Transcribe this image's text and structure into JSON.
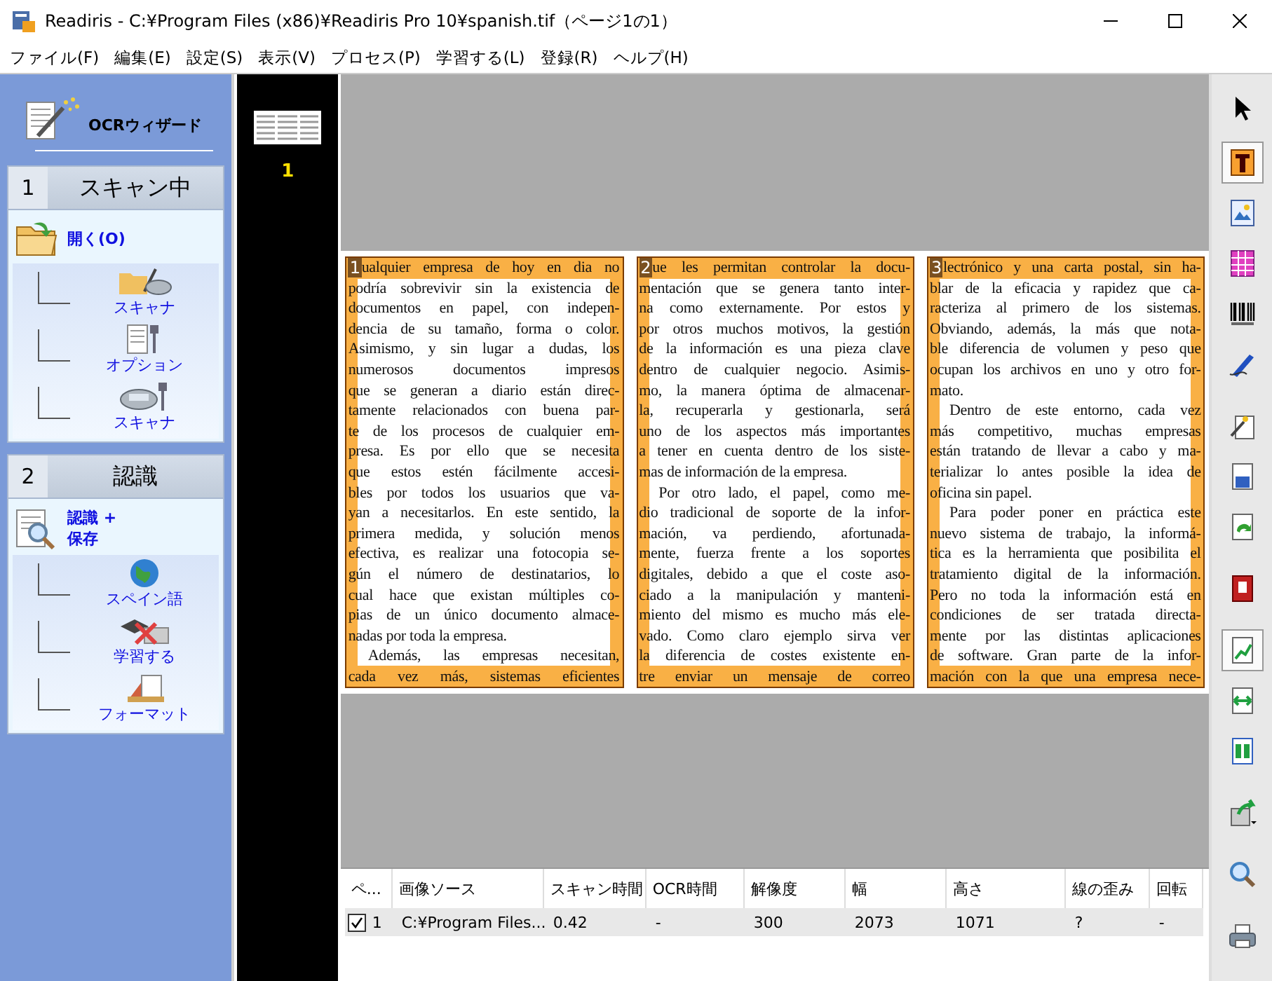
{
  "window": {
    "title": "Readiris - C:¥Program Files (x86)¥Readiris Pro 10¥spanish.tif（ページ1の1）"
  },
  "menu": [
    "ファイル(F)",
    "編集(E)",
    "設定(S)",
    "表示(V)",
    "プロセス(P)",
    "学習する(L)",
    "登録(R)",
    "ヘルプ(H)"
  ],
  "wizard": {
    "title": "OCRウィザード",
    "sections": [
      {
        "number": "1",
        "title": "スキャン中",
        "main": [
          "開く(O)"
        ],
        "items": [
          "スキャナ",
          "オプション",
          "スキャナ"
        ]
      },
      {
        "number": "2",
        "title": "認識",
        "main": [
          "認識 +",
          "保存"
        ],
        "items": [
          "スペイン語",
          "学習する",
          "フォーマット"
        ]
      }
    ]
  },
  "thumbnails": [
    {
      "number": "1"
    }
  ],
  "zones": [
    {
      "number": "1",
      "paragraphs": [
        {
          "indent": false,
          "lines": [
            "ualquier empresa de hoy en dia no",
            "podría sobrevivir sin la existencia de",
            "documentos en papel, con indepen-",
            "dencia de su tamaño, forma o color.",
            "Asimismo, y sin lugar a dudas, los",
            "numerosos documentos impresos",
            "que se generan a diario están direc-",
            "tamente relacionados con buena par-",
            "te de los procesos de cualquier em-",
            "presa. Es por ello que se necesita",
            "que estos estén fácilmente accesi-",
            "bles por todos los usuarios que va-",
            "yan a necesitarlos. En este sentido, la",
            "primera medida, y solución menos",
            "efectiva, es realizar una fotocopia se-",
            "gún el número de destinatarios, lo",
            "cual hace que existan múltiples co-",
            "pias de un único documento almace-",
            "nadas por toda la empresa."
          ]
        },
        {
          "indent": true,
          "lines": [
            "Además, las empresas necesitan,",
            "cada vez más, sistemas eficientes"
          ]
        }
      ]
    },
    {
      "number": "2",
      "paragraphs": [
        {
          "indent": false,
          "lines": [
            "ue les permitan controlar la docu-",
            "mentación que se genera tanto inter-",
            "na como externamente. Por estos y",
            "por otros muchos motivos, la gestión",
            "de la información es una pieza clave",
            "dentro de cualquier negocio. Asimis-",
            "mo, la manera óptima de almacenar-",
            "la, recuperarla y gestionarla, será",
            "uno de los aspectos más importantes",
            "a tener en cuenta dentro de los siste-",
            "mas de información de la empresa."
          ]
        },
        {
          "indent": true,
          "lines": [
            "Por otro lado, el papel, como me-",
            "dio tradicional de soporte de la infor-",
            "mación, va perdiendo, afortunada-",
            "mente, fuerza frente a los soportes",
            "digitales, debido a que el coste aso-",
            "ciado a la manipulación y manteni-",
            "miento del mismo es mucho más ele-",
            "vado. Como claro ejemplo sirva ver",
            "la diferencia de costes existente en-",
            "tre enviar un mensaje de correo"
          ]
        }
      ]
    },
    {
      "number": "3",
      "paragraphs": [
        {
          "indent": false,
          "lines": [
            "lectrónico y una carta postal, sin ha-",
            "blar de la eficacia y rapidez que ca-",
            "racteriza al primero de los sistemas.",
            "Obviando, además, la más que nota-",
            "ble diferencia de volumen y peso que",
            "ocupan los archivos en uno y otro for-",
            "mato."
          ]
        },
        {
          "indent": true,
          "lines": [
            "Dentro de este entorno, cada vez",
            "más competitivo, muchas empresas",
            "están tratando de llevar a cabo y ma-",
            "terializar lo antes posible la idea de",
            "oficina sin papel."
          ]
        },
        {
          "indent": true,
          "lines": [
            "Para poder poner en práctica este",
            "nuevo sistema de trabajo, la informá-",
            "tica es la herramienta que posibilita el",
            "tratamiento digital de la información.",
            "Pero no toda la información está en",
            "condiciones de ser tratada directa-",
            "mente por las distintas aplicaciones",
            "de software. Gran parte de la infor-",
            "mación con la que una empresa nece-"
          ]
        }
      ]
    }
  ],
  "table": {
    "columns": [
      "ペ...",
      "画像ソース",
      "スキャン時間",
      "OCR時間",
      "解像度",
      "幅",
      "高さ",
      "線の歪み",
      "回転"
    ],
    "rows": [
      {
        "checked": true,
        "cells": [
          "1",
          "C:¥Program Files...",
          "0.42",
          "-",
          "300",
          "2073",
          "1071",
          "?",
          "-"
        ]
      }
    ]
  },
  "toolbar": [
    {
      "pressed": false
    },
    {
      "pressed": true
    },
    {
      "pressed": false
    },
    {
      "pressed": false
    },
    {
      "pressed": false
    },
    {
      "pressed": false
    },
    {
      "pressed": false
    },
    {
      "pressed": false
    },
    {
      "pressed": false
    },
    {
      "pressed": false
    },
    {
      "pressed": true
    },
    {
      "pressed": false
    },
    {
      "pressed": false
    },
    {
      "pressed": false
    },
    {
      "pressed": false
    },
    {
      "pressed": false
    }
  ]
}
